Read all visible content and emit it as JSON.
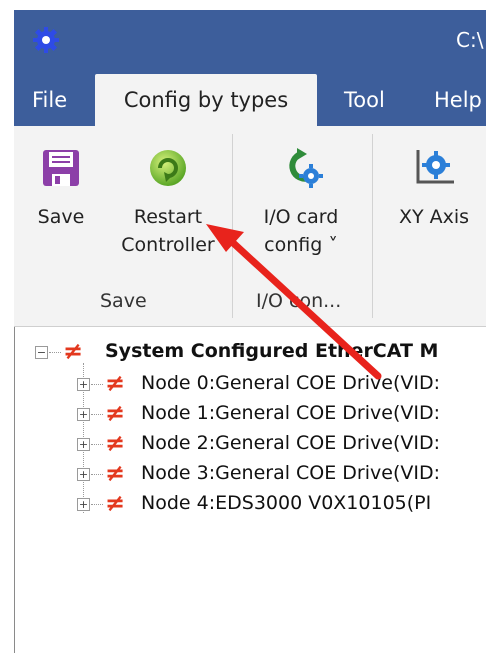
{
  "titlebar": {
    "path": "C:\\"
  },
  "tabs": {
    "file": "File",
    "config": "Config by types",
    "tool": "Tool",
    "help": "Help"
  },
  "ribbon": {
    "save": {
      "label": "Save"
    },
    "restart": {
      "line1": "Restart",
      "line2": "Controller"
    },
    "io_card": {
      "line1": "I/O card",
      "line2": "config ˅"
    },
    "xy_axis": {
      "label": "XY Axis"
    },
    "groups": {
      "save": "Save",
      "io": "I/O con..."
    }
  },
  "tree": {
    "root": "System Configured EtherCAT M",
    "nodes": [
      "Node 0:General COE Drive(VID:",
      "Node 1:General COE Drive(VID:",
      "Node 2:General COE Drive(VID:",
      "Node 3:General COE Drive(VID:",
      "Node 4:EDS3000 V0X10105(PI"
    ]
  },
  "colors": {
    "titlebar": "#3d5e9b",
    "status_icon": "#e3381e",
    "arrow": "#e8231c"
  }
}
